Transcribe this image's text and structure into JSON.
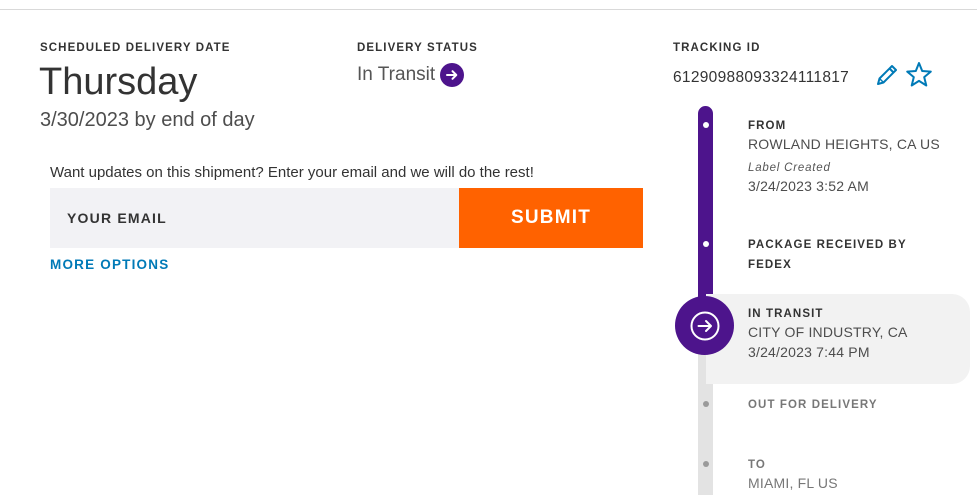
{
  "delivery": {
    "scheduled_label": "SCHEDULED DELIVERY DATE",
    "weekday": "Thursday",
    "date_line": "3/30/2023 by end of day"
  },
  "status": {
    "label": "DELIVERY STATUS",
    "value": "In Transit",
    "icon": "arrow-right-circle-icon"
  },
  "updates": {
    "prompt": "Want updates on this shipment? Enter your email and we will do the rest!",
    "email_placeholder": "YOUR EMAIL",
    "email_value": "",
    "submit_label": "SUBMIT",
    "more_options_label": "MORE OPTIONS"
  },
  "tracking": {
    "label": "TRACKING ID",
    "number": "612909880933241118​17",
    "edit_icon": "pencil-icon",
    "favorite_icon": "star-icon"
  },
  "timeline": {
    "events": [
      {
        "title": "FROM",
        "line1": "ROWLAND HEIGHTS, CA US",
        "sublabel": "Label Created",
        "line2": "3/24/2023 3:52 AM"
      },
      {
        "title_line1": "PACKAGE RECEIVED BY",
        "title_line2": "FEDEX"
      },
      {
        "title": "IN TRANSIT",
        "line1": "CITY OF INDUSTRY, CA",
        "line2": "3/24/2023 7:44 PM",
        "current": true
      },
      {
        "title": "OUT FOR DELIVERY"
      },
      {
        "title": "TO",
        "line1": "MIAMI, FL US"
      }
    ]
  },
  "colors": {
    "brand_purple": "#4d148c",
    "submit_orange": "#ff6200",
    "link_blue": "#007ab7",
    "track_grey": "#e3e3e3"
  }
}
